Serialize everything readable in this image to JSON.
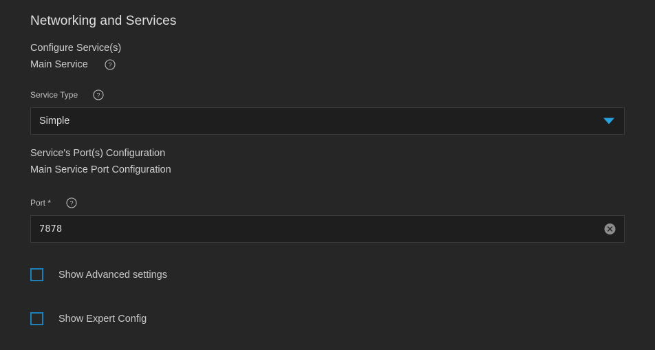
{
  "theme": {
    "background": "#262626",
    "field_background": "#1e1e1e",
    "field_border": "#3a3a3a",
    "accent_blue": "#29a3e0",
    "checkbox_blue": "#1e80b8",
    "heading_text": "#e0e0e0",
    "body_text": "#c9c9c9",
    "label_text": "#c2c2c2"
  },
  "page": {
    "section_title": "Networking and Services"
  },
  "configure_services": {
    "group_label": "Configure Service(s)",
    "subgroup_label": "Main Service",
    "help_icon": "help-circle-icon"
  },
  "service_type": {
    "label": "Service Type",
    "help_icon": "help-circle-icon",
    "value": "Simple",
    "options": [
      "Simple"
    ],
    "dropdown_icon": "chevron-down-icon"
  },
  "ports_config": {
    "group_label": "Service's Port(s) Configuration",
    "subgroup_label": "Main Service Port Configuration"
  },
  "port_field": {
    "label": "Port *",
    "help_icon": "help-circle-icon",
    "value": "7878",
    "placeholder": "",
    "clear_icon": "clear-circle-icon"
  },
  "checkboxes": [
    {
      "label": "Show Advanced settings",
      "checked": false,
      "name": "show-advanced-settings"
    },
    {
      "label": "Show Expert Config",
      "checked": false,
      "name": "show-expert-config"
    }
  ]
}
